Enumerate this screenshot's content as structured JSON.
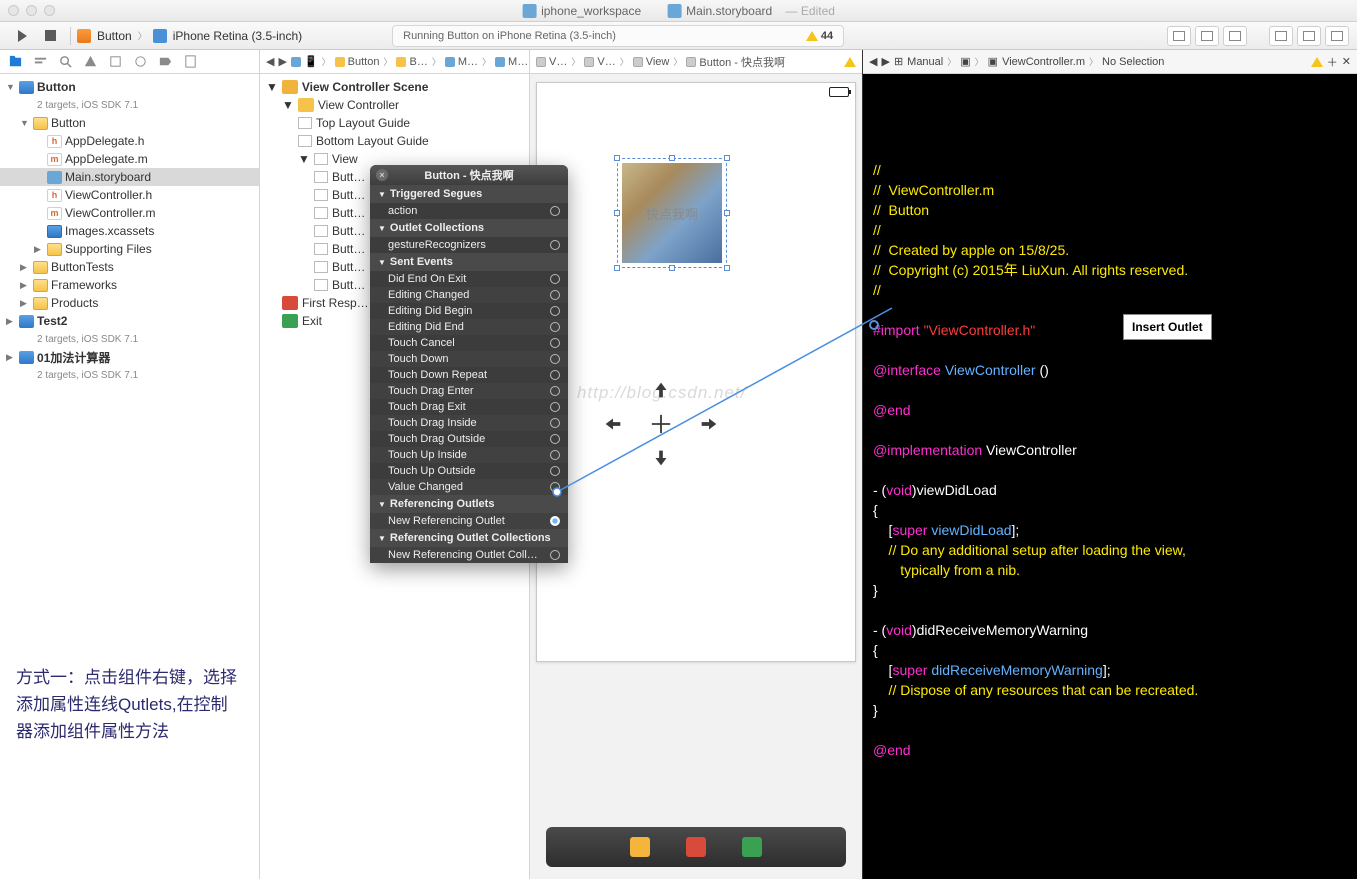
{
  "title": {
    "left": "iphone_workspace",
    "right": "Main.storyboard",
    "edited": "— Edited"
  },
  "toolbar": {
    "scheme_app": "Button",
    "scheme_device": "iPhone Retina (3.5-inch)",
    "status_text": "Running Button on iPhone Retina (3.5-inch)",
    "warning_count": "44"
  },
  "navigator": {
    "project": {
      "name": "Button",
      "subtitle": "2 targets, iOS SDK 7.1"
    },
    "items": [
      {
        "type": "folder",
        "label": "Button",
        "indent": 1,
        "open": true
      },
      {
        "type": "h",
        "label": "AppDelegate.h",
        "indent": 2
      },
      {
        "type": "m",
        "label": "AppDelegate.m",
        "indent": 2
      },
      {
        "type": "sb",
        "label": "Main.storyboard",
        "indent": 2,
        "selected": true
      },
      {
        "type": "h",
        "label": "ViewController.h",
        "indent": 2
      },
      {
        "type": "m",
        "label": "ViewController.m",
        "indent": 2
      },
      {
        "type": "asset",
        "label": "Images.xcassets",
        "indent": 2
      },
      {
        "type": "folder",
        "label": "Supporting Files",
        "indent": 2,
        "closed": true
      },
      {
        "type": "folder",
        "label": "ButtonTests",
        "indent": 1,
        "closed": true
      },
      {
        "type": "folder",
        "label": "Frameworks",
        "indent": 1,
        "closed": true
      },
      {
        "type": "folder",
        "label": "Products",
        "indent": 1,
        "closed": true
      }
    ],
    "project2": {
      "name": "Test2",
      "subtitle": "2 targets, iOS SDK 7.1"
    },
    "project3": {
      "name": "01加法计算器",
      "subtitle": "2 targets, iOS SDK 7.1"
    }
  },
  "annotation": "方式一：点击组件右键，选择添加属性连线Qutlets,在控制器添加组件属性方法",
  "jumpbar_outline": [
    "Button",
    "B…",
    "M…",
    "M…",
    "V…",
    "V…",
    "View",
    "Button - 快点我啊"
  ],
  "outline": {
    "scene": "View Controller Scene",
    "vc": "View Controller",
    "top_guide": "Top Layout Guide",
    "bottom_guide": "Bottom Layout Guide",
    "view": "View",
    "buttons": [
      "Butt…",
      "Butt…",
      "Butt…",
      "Butt…",
      "Butt…",
      "Butt…",
      "Butt…"
    ],
    "first_responder": "First Resp…",
    "exit": "Exit"
  },
  "popover": {
    "title": "Button - 快点我啊",
    "sections": [
      {
        "name": "Triggered Segues",
        "rows": [
          {
            "label": "action",
            "circle": true
          }
        ]
      },
      {
        "name": "Outlet Collections",
        "rows": [
          {
            "label": "gestureRecognizers",
            "circle": true
          }
        ]
      },
      {
        "name": "Sent Events",
        "rows": [
          {
            "label": "Did End On Exit",
            "circle": true
          },
          {
            "label": "Editing Changed",
            "circle": true
          },
          {
            "label": "Editing Did Begin",
            "circle": true
          },
          {
            "label": "Editing Did End",
            "circle": true
          },
          {
            "label": "Touch Cancel",
            "circle": true
          },
          {
            "label": "Touch Down",
            "circle": true
          },
          {
            "label": "Touch Down Repeat",
            "circle": true
          },
          {
            "label": "Touch Drag Enter",
            "circle": true
          },
          {
            "label": "Touch Drag Exit",
            "circle": true
          },
          {
            "label": "Touch Drag Inside",
            "circle": true
          },
          {
            "label": "Touch Drag Outside",
            "circle": true
          },
          {
            "label": "Touch Up Inside",
            "circle": true
          },
          {
            "label": "Touch Up Outside",
            "circle": true
          },
          {
            "label": "Value Changed",
            "circle": true
          }
        ]
      },
      {
        "name": "Referencing Outlets",
        "rows": [
          {
            "label": "New Referencing Outlet",
            "circle": true,
            "active": true
          }
        ]
      },
      {
        "name": "Referencing Outlet Collections",
        "rows": [
          {
            "label": "New Referencing Outlet Coll…",
            "circle": true
          }
        ]
      }
    ]
  },
  "canvas": {
    "button_text": "快点我啊",
    "watermark": "http://blog.csdn.net/"
  },
  "editor_jump": {
    "mode": "Manual",
    "file": "ViewController.m",
    "sel": "No Selection"
  },
  "editor": {
    "insert_tooltip": "Insert Outlet",
    "lines": [
      {
        "t": "cm",
        "s": "//"
      },
      {
        "t": "cm",
        "s": "//  ViewController.m"
      },
      {
        "t": "cm",
        "s": "//  Button"
      },
      {
        "t": "cm",
        "s": "//"
      },
      {
        "t": "cm",
        "s": "//  Created by apple on 15/8/25."
      },
      {
        "t": "cm",
        "s": "//  Copyright (c) 2015年 LiuXun. All rights reserved."
      },
      {
        "t": "cm",
        "s": "//"
      },
      {
        "t": "blank",
        "s": ""
      },
      {
        "t": "import",
        "s": "#import \"ViewController.h\""
      },
      {
        "t": "blank",
        "s": ""
      },
      {
        "t": "iface",
        "s": "@interface ViewController ()"
      },
      {
        "t": "blank",
        "s": ""
      },
      {
        "t": "end",
        "s": "@end"
      },
      {
        "t": "blank",
        "s": ""
      },
      {
        "t": "impl",
        "s": "@implementation ViewController"
      },
      {
        "t": "blank",
        "s": ""
      },
      {
        "t": "meth",
        "s": "- (void)viewDidLoad"
      },
      {
        "t": "plain",
        "s": "{"
      },
      {
        "t": "call",
        "s": "    [super viewDidLoad];"
      },
      {
        "t": "cm",
        "s": "    // Do any additional setup after loading the view,"
      },
      {
        "t": "cm",
        "s": "       typically from a nib."
      },
      {
        "t": "plain",
        "s": "}"
      },
      {
        "t": "blank",
        "s": ""
      },
      {
        "t": "meth",
        "s": "- (void)didReceiveMemoryWarning"
      },
      {
        "t": "plain",
        "s": "{"
      },
      {
        "t": "call",
        "s": "    [super didReceiveMemoryWarning];"
      },
      {
        "t": "cm",
        "s": "    // Dispose of any resources that can be recreated."
      },
      {
        "t": "plain",
        "s": "}"
      },
      {
        "t": "blank",
        "s": ""
      },
      {
        "t": "end",
        "s": "@end"
      }
    ]
  }
}
